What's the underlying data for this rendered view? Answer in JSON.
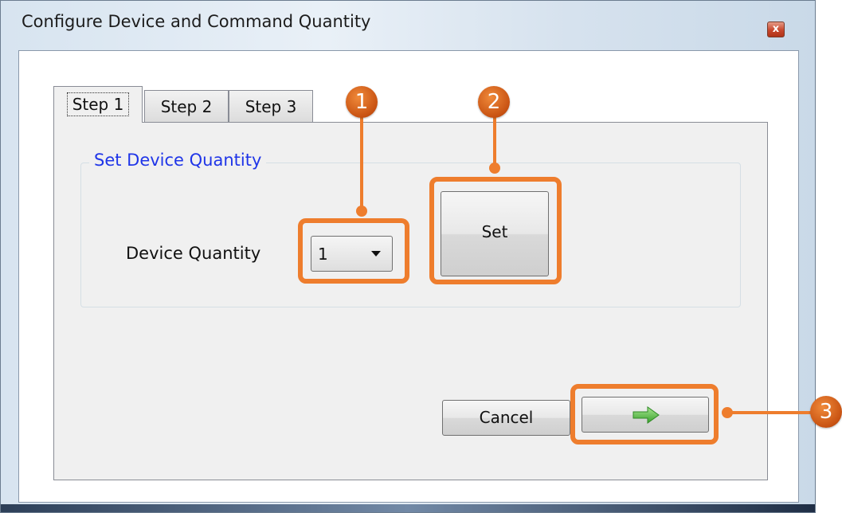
{
  "window": {
    "title": "Configure Device and Command Quantity",
    "close_label": "x"
  },
  "tabs": [
    {
      "label": "Step 1",
      "selected": true
    },
    {
      "label": "Step 2",
      "selected": false
    },
    {
      "label": "Step 3",
      "selected": false
    }
  ],
  "group": {
    "title": "Set Device Quantity",
    "device_quantity_label": "Device Quantity",
    "device_quantity_value": "1",
    "set_label": "Set"
  },
  "footer": {
    "cancel_label": "Cancel",
    "next_icon": "right-arrow-icon"
  },
  "callouts": [
    {
      "number": "1"
    },
    {
      "number": "2"
    },
    {
      "number": "3"
    }
  ],
  "colors": {
    "callout": "#ee7d2d",
    "group_title": "#1f35e8",
    "arrow": "#5cc04a"
  }
}
